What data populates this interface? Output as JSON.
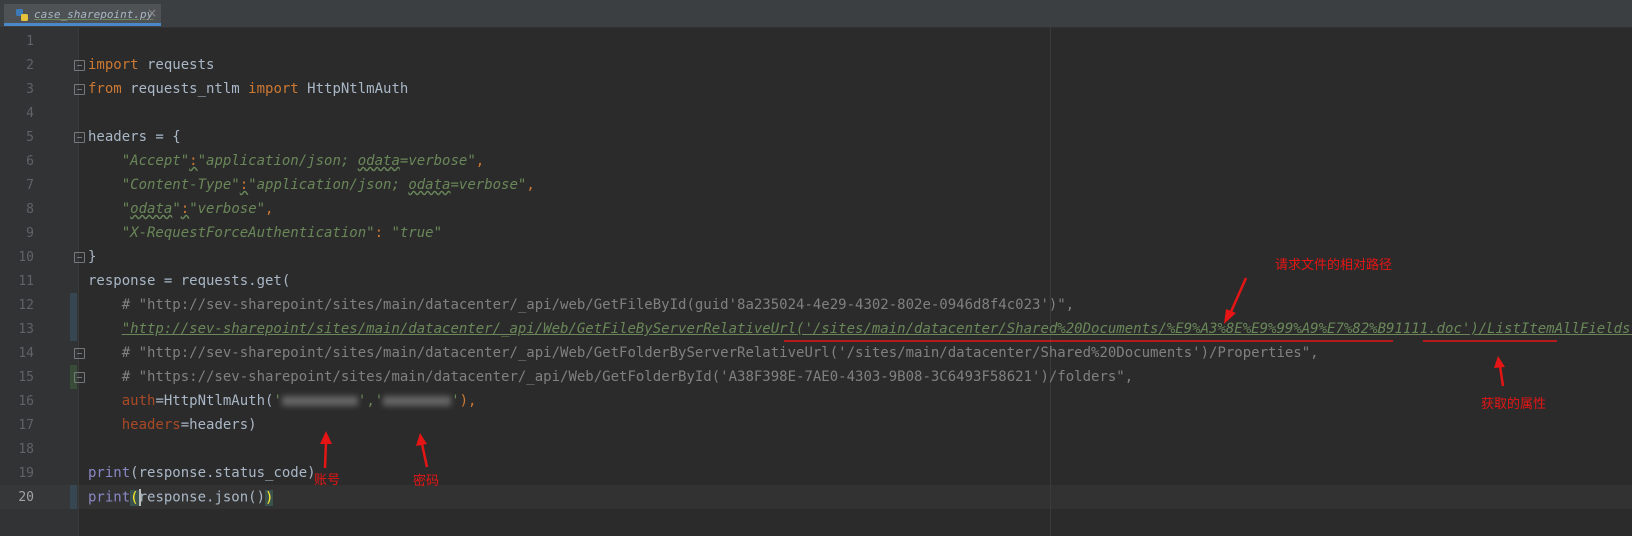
{
  "tab": {
    "filename": "case_sharepoint.py",
    "close_glyph": "×"
  },
  "lines": {
    "n1": "1",
    "n2": "2",
    "n3": "3",
    "n4": "4",
    "n5": "5",
    "n6": "6",
    "n7": "7",
    "n8": "8",
    "n9": "9",
    "n10": "10",
    "n11": "11",
    "n12": "12",
    "n13": "13",
    "n14": "14",
    "n15": "15",
    "n16": "16",
    "n17": "17",
    "n18": "18",
    "n19": "19",
    "n20": "20"
  },
  "code": {
    "l2_kw": "import",
    "l2_rest": " requests",
    "l3_kw1": "from",
    "l3_mod": " requests_ntlm ",
    "l3_kw2": "import",
    "l3_rest": " HttpNtlmAuth",
    "l5": "headers = {",
    "l6_indent": "    ",
    "l6_k": "\"Accept\"",
    "l6_c": ":",
    "l6_v1": "\"application/json; ",
    "l6_v2": "odata",
    "l6_v3": "=verbose\"",
    "l6_end": ",",
    "l7_indent": "    ",
    "l7_k": "\"Content-Type\"",
    "l7_c": ":",
    "l7_v1": "\"application/json; ",
    "l7_v2": "odata",
    "l7_v3": "=verbose\"",
    "l7_end": ",",
    "l8_indent": "    ",
    "l8_k1": "\"",
    "l8_k2": "odata",
    "l8_k3": "\"",
    "l8_c": ":",
    "l8_v": "\"verbose\"",
    "l8_end": ",",
    "l9_indent": "    ",
    "l9_k": "\"X-RequestForceAuthentication\"",
    "l9_c": ": ",
    "l9_v": "\"true\"",
    "l10": "}",
    "l11": "response = requests.get(",
    "l12_indent": "    ",
    "l12": "# \"http://sev-sharepoint/sites/main/datacenter/_api/web/GetFileById(guid'8a235024-4e29-4302-802e-0946d8f4c023')\",",
    "l13_indent": "    ",
    "l13_s": "\"http://sev-sharepoint/sites/main/datacenter/_api/Web/GetFileByServerRelativeUrl('/sites/main/datacenter/Shared%20Documents/%E9%A3%8E%E9%99%A9%E7%82%B91111.doc')/ListItemAllFields\"",
    "l13_end": ",",
    "l14_indent": "    ",
    "l14": "# \"http://sev-sharepoint/sites/main/datacenter/_api/Web/GetFolderByServerRelativeUrl('/sites/main/datacenter/Shared%20Documents')/Properties\",",
    "l15_indent": "    ",
    "l15": "# \"https://sev-sharepoint/sites/main/datacenter/_api/Web/GetFolderById('A38F398E-7AE0-4303-9B08-3C6493F58621')/folders\",",
    "l16_indent": "    ",
    "l16_p": "auth",
    "l16_a": "=HttpNtlmAuth(",
    "l16_q1": "'",
    "l16_q2": "',",
    "l16_q3": "'",
    "l16_q4": "'",
    "l16_end": "),",
    "l17_indent": "    ",
    "l17_p": "headers",
    "l17_a": "=headers)",
    "l19_fn": "print",
    "l19_rest": "(response.status_code)",
    "l20_fn": "print",
    "l20_open": "(",
    "l20_mid": "response.json()",
    "l20_close": ")"
  },
  "annotations": {
    "path": "请求文件的相对路径",
    "prop": "获取的属性",
    "account": "账号",
    "password": "密码"
  },
  "colors": {
    "annotation": "#e51515",
    "keyword": "#cc7832",
    "string": "#6a8759",
    "comment": "#808080"
  }
}
